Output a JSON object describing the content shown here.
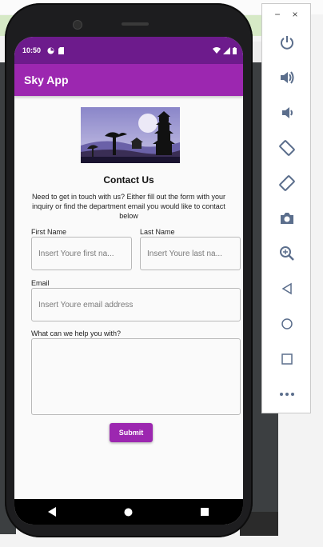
{
  "colors": {
    "appbar": "#9c27b0",
    "statusbar": "#6d1b8c",
    "button": "#9c27b0",
    "tool_icon": "#5b6e8c"
  },
  "status": {
    "time": "10:50"
  },
  "app": {
    "title": "Sky App",
    "contact": {
      "title": "Contact Us",
      "description": "Need to get in touch with us? Either fill out the form with your inquiry or find the department email you would like to contact below",
      "first_name_label": "First Name",
      "first_name_placeholder": "Insert Youre first na...",
      "last_name_label": "Last Name",
      "last_name_placeholder": "Insert Youre last na...",
      "email_label": "Email",
      "email_placeholder": "Insert Youre email address",
      "message_label": "What can we help you with?",
      "message_value": "",
      "submit_label": "Submit"
    }
  },
  "emulator_panel": {
    "minimize": "−",
    "close": "×",
    "tools": [
      "power-icon",
      "volume-up-icon",
      "volume-down-icon",
      "rotate-left-icon",
      "rotate-right-icon",
      "camera-icon",
      "zoom-icon",
      "back-icon",
      "home-icon",
      "overview-icon",
      "more-icon"
    ]
  }
}
